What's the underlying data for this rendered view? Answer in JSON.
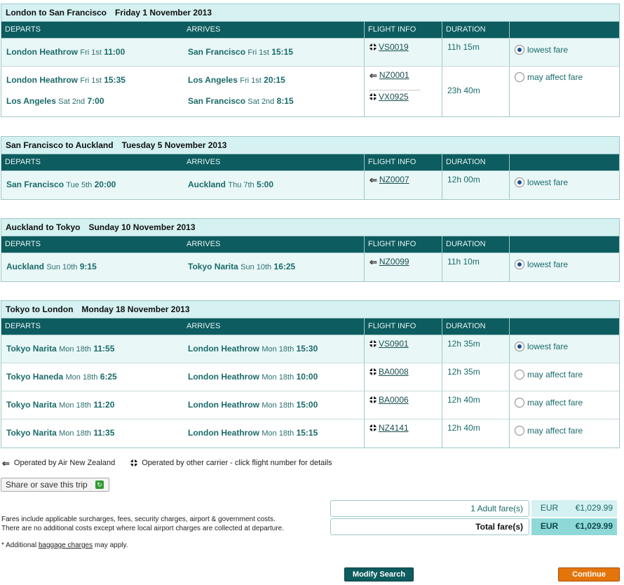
{
  "columns": {
    "departs": "DEPARTS",
    "arrives": "ARRIVES",
    "flight": "FLIGHT INFO",
    "duration": "DURATION"
  },
  "legs": [
    {
      "route": "London to San Francisco",
      "date": "Friday 1 November 2013",
      "options": [
        {
          "type": "single",
          "selected": true,
          "segments": [
            {
              "dep_place": "London Heathrow",
              "dep_day": "Fri 1st",
              "dep_time": "11:00",
              "arr_place": "San Francisco",
              "arr_day": "Fri 1st",
              "arr_time": "15:15",
              "flight": "VS0019",
              "carrier": "other"
            }
          ],
          "duration": "11h 15m",
          "fare": "lowest fare"
        },
        {
          "type": "multi",
          "selected": false,
          "segments": [
            {
              "dep_place": "London Heathrow",
              "dep_day": "Fri 1st",
              "dep_time": "15:35",
              "arr_place": "Los Angeles",
              "arr_day": "Fri 1st",
              "arr_time": "20:15",
              "flight": "NZ0001",
              "carrier": "nz"
            },
            {
              "dep_place": "Los Angeles",
              "dep_day": "Sat 2nd",
              "dep_time": "7:00",
              "arr_place": "San Francisco",
              "arr_day": "Sat 2nd",
              "arr_time": "8:15",
              "flight": "VX0925",
              "carrier": "other"
            }
          ],
          "duration": "23h 40m",
          "fare": "may affect fare"
        }
      ]
    },
    {
      "route": "San Francisco to Auckland",
      "date": "Tuesday 5 November 2013",
      "options": [
        {
          "type": "single",
          "selected": true,
          "segments": [
            {
              "dep_place": "San Francisco",
              "dep_day": "Tue 5th",
              "dep_time": "20:00",
              "arr_place": "Auckland",
              "arr_day": "Thu 7th",
              "arr_time": "5:00",
              "flight": "NZ0007",
              "carrier": "nz"
            }
          ],
          "duration": "12h 00m",
          "fare": "lowest fare"
        }
      ]
    },
    {
      "route": "Auckland to Tokyo",
      "date": "Sunday 10 November 2013",
      "options": [
        {
          "type": "single",
          "selected": true,
          "segments": [
            {
              "dep_place": "Auckland",
              "dep_day": "Sun 10th",
              "dep_time": "9:15",
              "arr_place": "Tokyo Narita",
              "arr_day": "Sun 10th",
              "arr_time": "16:25",
              "flight": "NZ0099",
              "carrier": "nz"
            }
          ],
          "duration": "11h 10m",
          "fare": "lowest fare"
        }
      ]
    },
    {
      "route": "Tokyo to London",
      "date": "Monday 18 November 2013",
      "options": [
        {
          "type": "single",
          "selected": true,
          "segments": [
            {
              "dep_place": "Tokyo Narita",
              "dep_day": "Mon 18th",
              "dep_time": "11:55",
              "arr_place": "London Heathrow",
              "arr_day": "Mon 18th",
              "arr_time": "15:30",
              "flight": "VS0901",
              "carrier": "other"
            }
          ],
          "duration": "12h 35m",
          "fare": "lowest fare"
        },
        {
          "type": "single",
          "selected": false,
          "segments": [
            {
              "dep_place": "Tokyo Haneda",
              "dep_day": "Mon 18th",
              "dep_time": "6:25",
              "arr_place": "London Heathrow",
              "arr_day": "Mon 18th",
              "arr_time": "10:00",
              "flight": "BA0008",
              "carrier": "other"
            }
          ],
          "duration": "12h 35m",
          "fare": "may affect fare"
        },
        {
          "type": "single",
          "selected": false,
          "segments": [
            {
              "dep_place": "Tokyo Narita",
              "dep_day": "Mon 18th",
              "dep_time": "11:20",
              "arr_place": "London Heathrow",
              "arr_day": "Mon 18th",
              "arr_time": "15:00",
              "flight": "BA0006",
              "carrier": "other"
            }
          ],
          "duration": "12h 40m",
          "fare": "may affect fare"
        },
        {
          "type": "single",
          "selected": false,
          "segments": [
            {
              "dep_place": "Tokyo Narita",
              "dep_day": "Mon 18th",
              "dep_time": "11:35",
              "arr_place": "London Heathrow",
              "arr_day": "Mon 18th",
              "arr_time": "15:15",
              "flight": "NZ4141",
              "carrier": "other"
            }
          ],
          "duration": "12h 40m",
          "fare": "may affect fare"
        }
      ]
    }
  ],
  "legend": {
    "nz": "Operated by Air New Zealand",
    "other": "Operated by other carrier - click flight number for details"
  },
  "share_label": "Share or save this trip",
  "notes": [
    "Fares include applicable surcharges, fees, security charges, airport & government costs.",
    "There are no additional costs except where local airport charges are collected at departure."
  ],
  "baggage": {
    "prefix": "* Additional ",
    "link": "baggage charges",
    "suffix": " may apply."
  },
  "fares": {
    "adult": {
      "label": "1 Adult fare(s)",
      "currency": "EUR",
      "amount": "€1,029.99"
    },
    "total": {
      "label": "Total fare(s)",
      "currency": "EUR",
      "amount": "€1,029.99"
    }
  },
  "buttons": {
    "modify": "Modify Search",
    "continue": "Continue"
  }
}
